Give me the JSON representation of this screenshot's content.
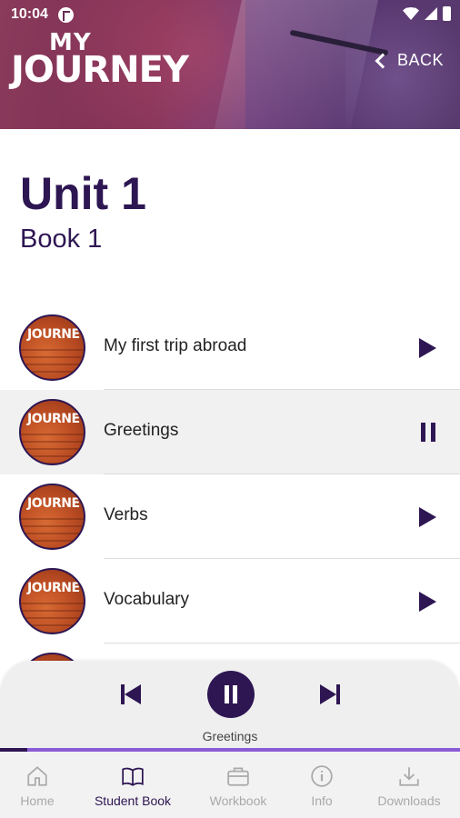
{
  "status_bar": {
    "time": "10:04"
  },
  "header": {
    "logo_line1": "MY",
    "logo_line2": "JOURNEY",
    "back_label": "BACK"
  },
  "unit": {
    "title": "Unit 1",
    "subtitle": "Book 1"
  },
  "tracks": [
    {
      "title": "My first trip abroad",
      "state": "play",
      "thumb_text": "JOURNEY"
    },
    {
      "title": "Greetings",
      "state": "pause",
      "thumb_text": "JOURNEY"
    },
    {
      "title": "Verbs",
      "state": "play",
      "thumb_text": "JOURNEY"
    },
    {
      "title": "Vocabulary",
      "state": "play",
      "thumb_text": "JOURNEY"
    }
  ],
  "player": {
    "now_playing": "Greetings",
    "progress": 0.06
  },
  "bottom_nav": [
    {
      "label": "Home",
      "icon": "home-icon",
      "active": false
    },
    {
      "label": "Student Book",
      "icon": "book-icon",
      "active": true
    },
    {
      "label": "Workbook",
      "icon": "briefcase-icon",
      "active": false
    },
    {
      "label": "Info",
      "icon": "info-icon",
      "active": false
    },
    {
      "label": "Downloads",
      "icon": "download-icon",
      "active": false
    }
  ],
  "colors": {
    "primary": "#2e1653",
    "accent": "#8a5bd6",
    "inactive": "#a9a9a9"
  }
}
